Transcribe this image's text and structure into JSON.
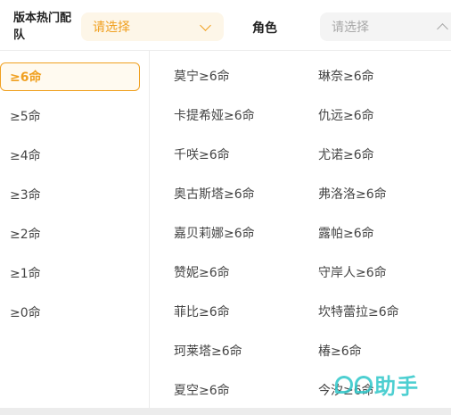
{
  "filters": {
    "version_label": "版本热门配队",
    "version_placeholder": "请选择",
    "role_label": "角色",
    "role_placeholder": "请选择"
  },
  "levels": [
    "≥6命",
    "≥5命",
    "≥4命",
    "≥3命",
    "≥2命",
    "≥1命",
    "≥0命"
  ],
  "active_level_index": 0,
  "characters": [
    "莫宁≥6命",
    "琳奈≥6命",
    "卡提希娅≥6命",
    "仇远≥6命",
    "千咲≥6命",
    "尤诺≥6命",
    "奥古斯塔≥6命",
    "弗洛洛≥6命",
    "嘉贝莉娜≥6命",
    "露帕≥6命",
    "赞妮≥6命",
    "守岸人≥6命",
    "菲比≥6命",
    "坎特蕾拉≥6命",
    "珂莱塔≥6命",
    "椿≥6命",
    "夏空≥6命",
    "今汐≥6命"
  ],
  "watermark": {
    "text": "助手",
    "logo_icon": "pp-logo-icon"
  },
  "colors": {
    "accent": "#f0a020",
    "watermark": "#2ec7c9"
  }
}
